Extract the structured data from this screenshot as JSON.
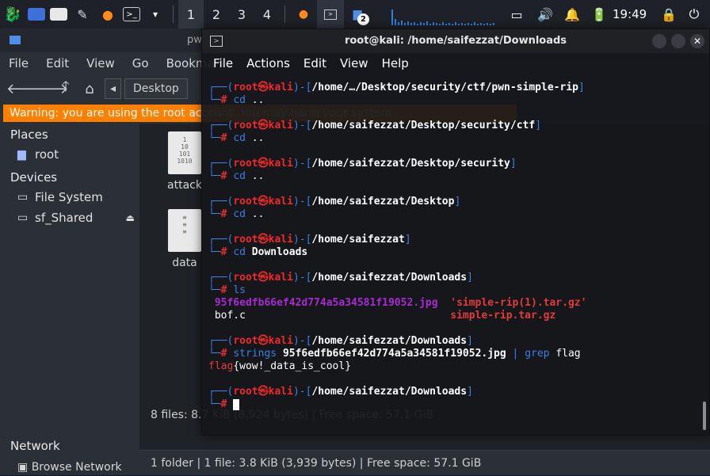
{
  "taskbar": {
    "workspaces": [
      "1",
      "2",
      "3",
      "4"
    ],
    "notify_count": "2",
    "clock": "19:49"
  },
  "file_manager": {
    "title": "pwn-simple-rip - Thunar",
    "menu": [
      "File",
      "Edit",
      "View",
      "Go",
      "Bookmarks"
    ],
    "breadcrumb": "Desktop",
    "warning": "Warning: you are using the root account. You may harm your system.",
    "places_header": "Places",
    "places": [
      "root"
    ],
    "devices_header": "Devices",
    "devices": [
      "File System",
      "sf_Shared"
    ],
    "network_header": "Network",
    "network_item": "Browse Network",
    "files": [
      "attack",
      "data"
    ],
    "status_ghost": "8 files: 8.7 KiB (8,924 bytes) | Free space: 57.1 GiB",
    "status": "1 folder  |  1 file: 3.8 KiB (3,939 bytes)  |  Free space: 57.1 GiB"
  },
  "terminal": {
    "title": "root@kali: /home/saifezzat/Downloads",
    "menu": [
      "File",
      "Actions",
      "Edit",
      "View",
      "Help"
    ],
    "user": "root㉿kali",
    "blocks": [
      {
        "path": "/home/…/Desktop/security/ctf/pwn-simple-rip",
        "cmd": "cd",
        "arg": ".."
      },
      {
        "path": "/home/saifezzat/Desktop/security/ctf",
        "cmd": "cd",
        "arg": ".."
      },
      {
        "path": "/home/saifezzat/Desktop/security",
        "cmd": "cd",
        "arg": ".."
      },
      {
        "path": "/home/saifezzat/Desktop",
        "cmd": "cd",
        "arg": ".."
      },
      {
        "path": "/home/saifezzat",
        "cmd": "cd",
        "arg": "Downloads"
      },
      {
        "path": "/home/saifezzat/Downloads",
        "cmd": "ls",
        "arg": ""
      }
    ],
    "ls_output": {
      "jpg": "95f6edfb66ef42d774a5a34581f19052.jpg",
      "tar1": "'simple-rip(1).tar.gz'",
      "bofc": "bof.c",
      "tar2": "simple-rip.tar.gz"
    },
    "strings_block": {
      "path": "/home/saifezzat/Downloads",
      "cmd": "strings",
      "arg": "95f6edfb66ef42d774a5a34581f19052.jpg",
      "pipe": "|",
      "grep": "grep",
      "grep_arg": "flag",
      "result_prefix": "flag",
      "result_rest": "{wow!_data_is_cool}"
    },
    "final_path": "/home/saifezzat/Downloads"
  }
}
